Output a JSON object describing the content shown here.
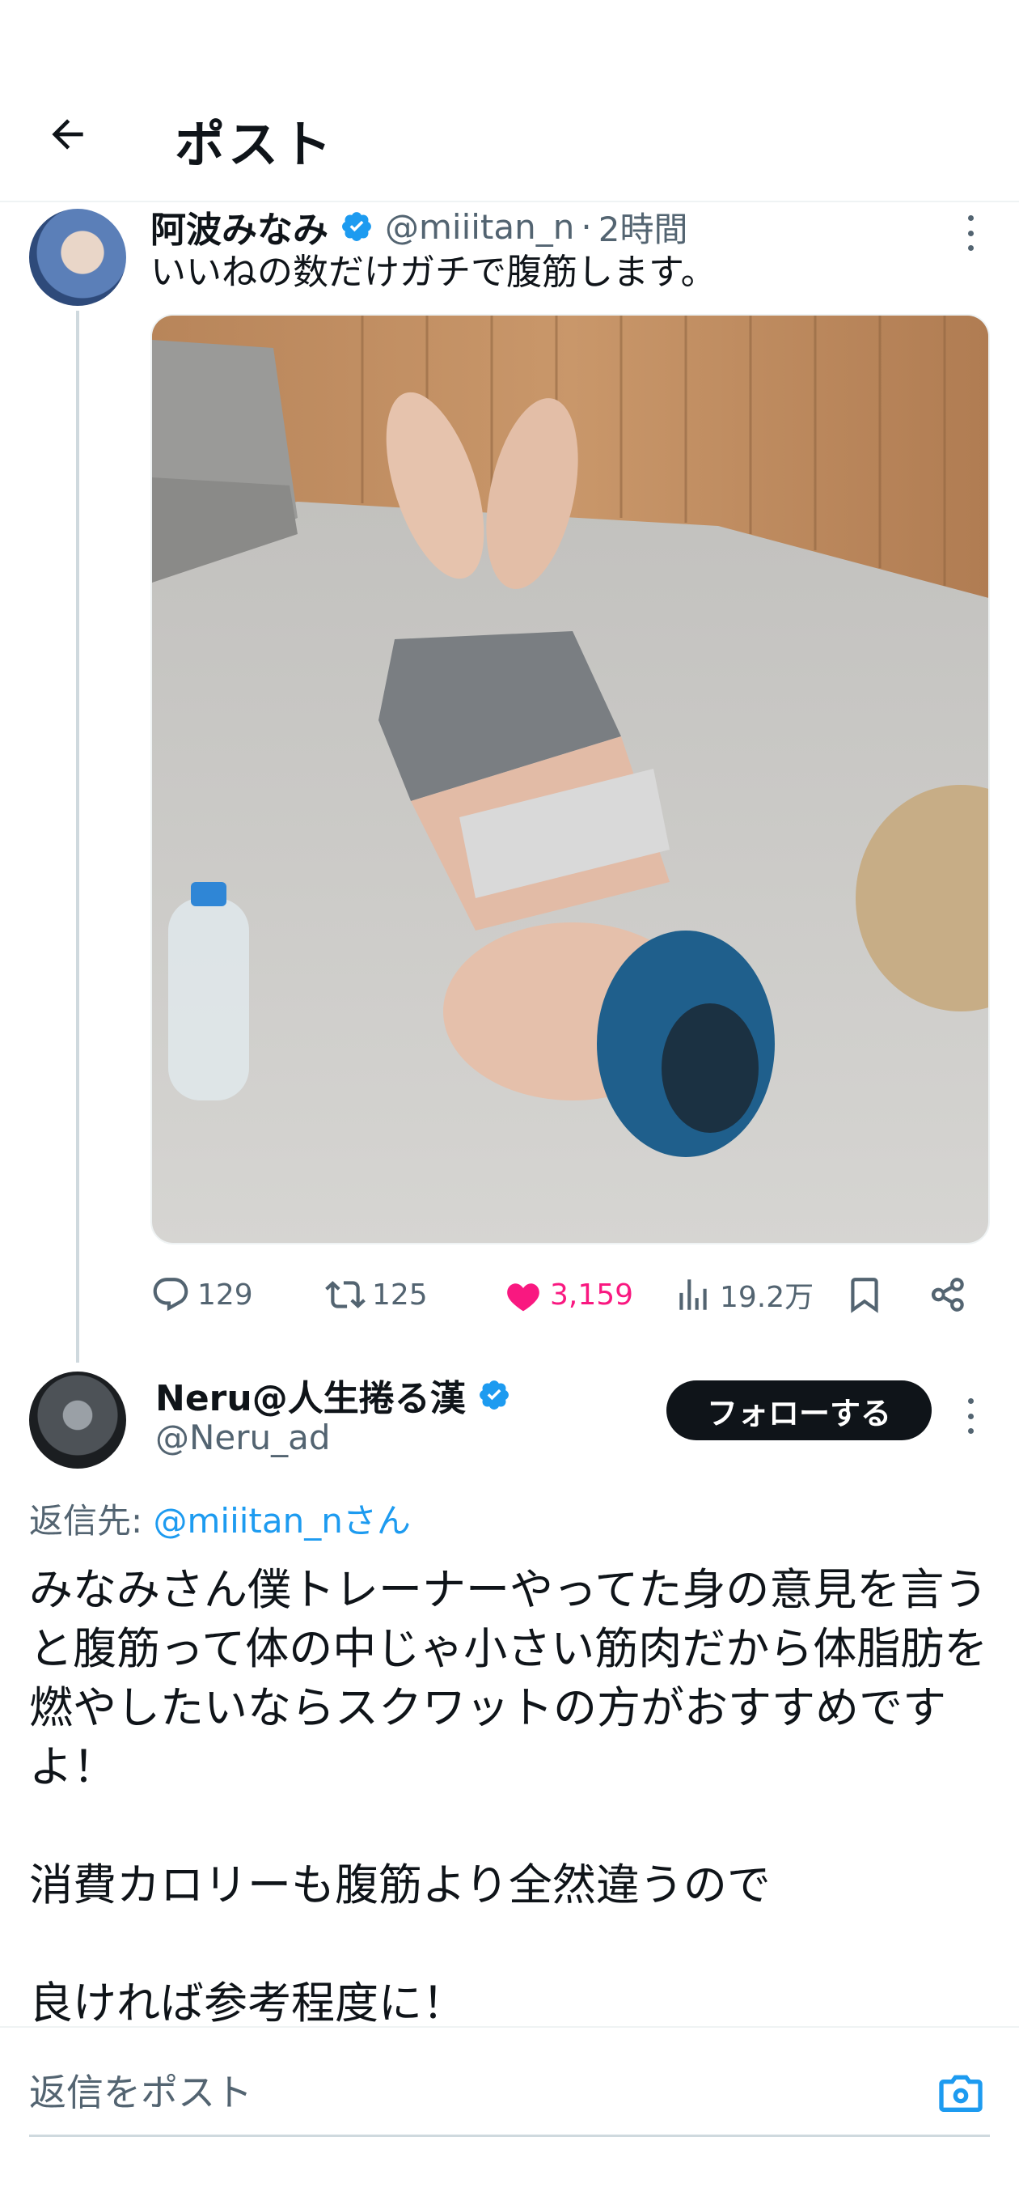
{
  "header": {
    "title": "ポスト",
    "back_icon": "arrow-left-icon"
  },
  "tweet": {
    "display_name": "阿波みなみ",
    "handle": "@miiitan_n",
    "separator": "·",
    "time": "2時間",
    "text": "いいねの数だけガチで腹筋します。",
    "stats": {
      "replies": "129",
      "retweets": "125",
      "likes": "3,159",
      "views": "19.2万"
    },
    "liked": true
  },
  "reply": {
    "display_name": "Neru@人生捲る漢",
    "handle": "@Neru_ad",
    "follow_label": "フォローする",
    "reply_to_prefix": "返信先:",
    "reply_to_mention": "@miiitan_nさん",
    "text": "みなみさん僕トレーナーやってた身の意見を言うと腹筋って体の中じゃ小さい筋肉だから体脂肪を燃やしたいならスクワットの方がおすすめですよ！\n\n消費カロリーも腹筋より全然違うので\n\n良ければ参考程度に！"
  },
  "composer": {
    "placeholder": "返信をポスト"
  },
  "colors": {
    "text": "#0f1419",
    "secondary": "#536471",
    "accent": "#1d9bf0",
    "like": "#f91880"
  }
}
